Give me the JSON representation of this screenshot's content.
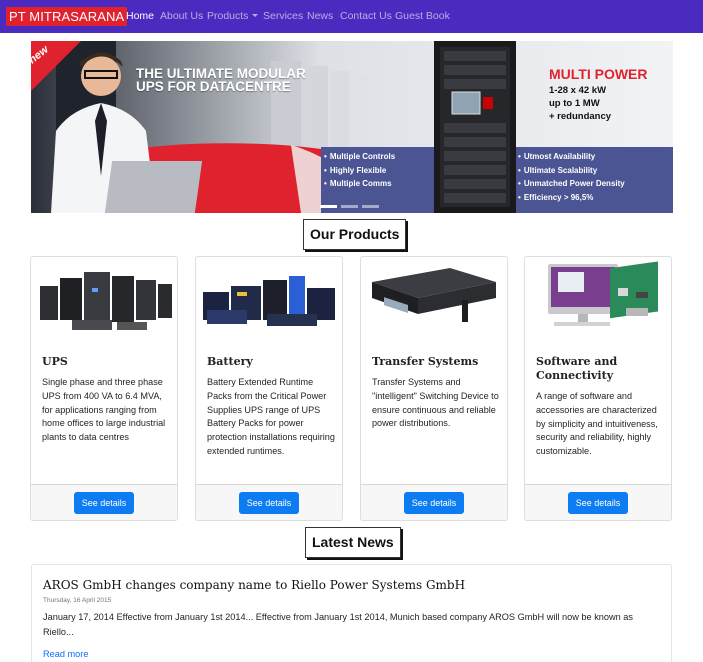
{
  "brand": "PT MITRASARANA",
  "nav": {
    "items": [
      {
        "label": "Home",
        "active": true
      },
      {
        "label": "About Us",
        "active": false
      },
      {
        "label": "Products",
        "active": false,
        "dropdown": true
      },
      {
        "label": "Services",
        "active": false
      },
      {
        "label": "News",
        "active": false
      },
      {
        "label": "Contact Us",
        "active": false
      },
      {
        "label": "Guest Book",
        "active": false
      }
    ]
  },
  "banner": {
    "badge": "new",
    "headline": "THE ULTIMATE MODULAR UPS FOR DATACENTRE",
    "product_title": "MULTI POWER",
    "product_specs": [
      "1-28 x 42 kW",
      "up to 1 MW",
      "+ redundancy"
    ],
    "features_left": [
      "Multiple Controls",
      "Highly Flexible",
      "Multiple Comms"
    ],
    "features_right": [
      "Utmost Availability",
      "Ultimate Scalability",
      "Unmatched Power Density",
      "Efficiency > 96,5%"
    ],
    "slide_count": 3,
    "active_slide": 1
  },
  "products_title": "Our Products",
  "products": [
    {
      "title": "UPS",
      "text": "Single phase and three phase UPS from 400 VA to 6.4 MVA, for applications ranging from home offices to large industrial plants to data centres",
      "button": "See details",
      "image_icon": "ups-units-image"
    },
    {
      "title": "Battery",
      "text": "Battery Extended Runtime Packs from the Critical Power Supplies UPS range of UPS Battery Packs for power protection installations requiring extended runtimes.",
      "button": "See details",
      "image_icon": "battery-packs-image"
    },
    {
      "title": "Transfer Systems",
      "text": "Transfer Systems and \"intelligent\" Switching Device to ensure continuous and reliable power distributions.",
      "button": "See details",
      "image_icon": "rack-switch-image"
    },
    {
      "title": "Software and Connectivity",
      "text": "A range of software and accessories are characterized by simplicity and intuitiveness, security and reliability, highly customizable.",
      "button": "See details",
      "image_icon": "computer-software-image"
    }
  ],
  "news_title": "Latest News",
  "news": [
    {
      "title": "AROS GmbH changes company name to Riello Power Systems GmbH",
      "date": "Thursday, 16 April 2015",
      "body": "January 17, 2014 Effective from January 1st 2014... Effective from January 1st 2014, Munich based company AROS GmbH will now be known as Riello...",
      "link": "Read more"
    }
  ],
  "colors": {
    "navbar": "#4b2bbf",
    "brand": "#e0222f",
    "button": "#0d7cf2",
    "link": "#0d6efd",
    "banner_accent": "#e0222f",
    "banner_band": "#4b5593"
  }
}
